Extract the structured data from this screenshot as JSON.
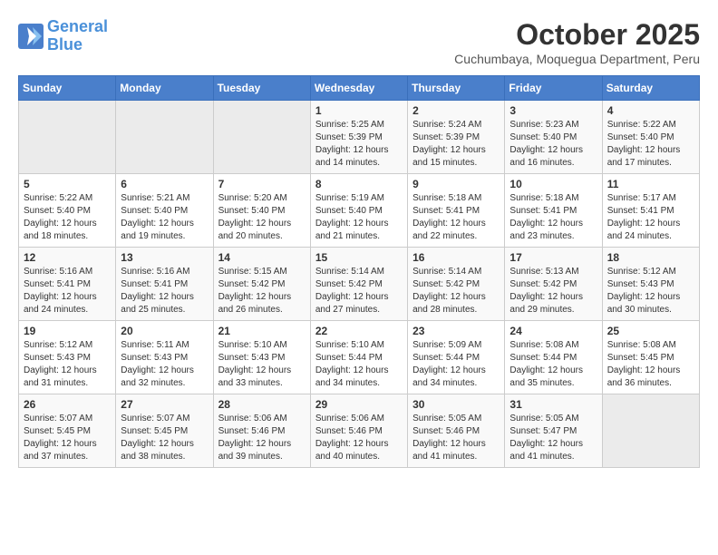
{
  "header": {
    "logo_line1": "General",
    "logo_line2": "Blue",
    "month": "October 2025",
    "location": "Cuchumbaya, Moquegua Department, Peru"
  },
  "weekdays": [
    "Sunday",
    "Monday",
    "Tuesday",
    "Wednesday",
    "Thursday",
    "Friday",
    "Saturday"
  ],
  "weeks": [
    [
      {
        "day": "",
        "sunrise": "",
        "sunset": "",
        "daylight": ""
      },
      {
        "day": "",
        "sunrise": "",
        "sunset": "",
        "daylight": ""
      },
      {
        "day": "",
        "sunrise": "",
        "sunset": "",
        "daylight": ""
      },
      {
        "day": "1",
        "sunrise": "5:25 AM",
        "sunset": "5:39 PM",
        "daylight": "12 hours and 14 minutes."
      },
      {
        "day": "2",
        "sunrise": "5:24 AM",
        "sunset": "5:39 PM",
        "daylight": "12 hours and 15 minutes."
      },
      {
        "day": "3",
        "sunrise": "5:23 AM",
        "sunset": "5:40 PM",
        "daylight": "12 hours and 16 minutes."
      },
      {
        "day": "4",
        "sunrise": "5:22 AM",
        "sunset": "5:40 PM",
        "daylight": "12 hours and 17 minutes."
      }
    ],
    [
      {
        "day": "5",
        "sunrise": "5:22 AM",
        "sunset": "5:40 PM",
        "daylight": "12 hours and 18 minutes."
      },
      {
        "day": "6",
        "sunrise": "5:21 AM",
        "sunset": "5:40 PM",
        "daylight": "12 hours and 19 minutes."
      },
      {
        "day": "7",
        "sunrise": "5:20 AM",
        "sunset": "5:40 PM",
        "daylight": "12 hours and 20 minutes."
      },
      {
        "day": "8",
        "sunrise": "5:19 AM",
        "sunset": "5:40 PM",
        "daylight": "12 hours and 21 minutes."
      },
      {
        "day": "9",
        "sunrise": "5:18 AM",
        "sunset": "5:41 PM",
        "daylight": "12 hours and 22 minutes."
      },
      {
        "day": "10",
        "sunrise": "5:18 AM",
        "sunset": "5:41 PM",
        "daylight": "12 hours and 23 minutes."
      },
      {
        "day": "11",
        "sunrise": "5:17 AM",
        "sunset": "5:41 PM",
        "daylight": "12 hours and 24 minutes."
      }
    ],
    [
      {
        "day": "12",
        "sunrise": "5:16 AM",
        "sunset": "5:41 PM",
        "daylight": "12 hours and 24 minutes."
      },
      {
        "day": "13",
        "sunrise": "5:16 AM",
        "sunset": "5:41 PM",
        "daylight": "12 hours and 25 minutes."
      },
      {
        "day": "14",
        "sunrise": "5:15 AM",
        "sunset": "5:42 PM",
        "daylight": "12 hours and 26 minutes."
      },
      {
        "day": "15",
        "sunrise": "5:14 AM",
        "sunset": "5:42 PM",
        "daylight": "12 hours and 27 minutes."
      },
      {
        "day": "16",
        "sunrise": "5:14 AM",
        "sunset": "5:42 PM",
        "daylight": "12 hours and 28 minutes."
      },
      {
        "day": "17",
        "sunrise": "5:13 AM",
        "sunset": "5:42 PM",
        "daylight": "12 hours and 29 minutes."
      },
      {
        "day": "18",
        "sunrise": "5:12 AM",
        "sunset": "5:43 PM",
        "daylight": "12 hours and 30 minutes."
      }
    ],
    [
      {
        "day": "19",
        "sunrise": "5:12 AM",
        "sunset": "5:43 PM",
        "daylight": "12 hours and 31 minutes."
      },
      {
        "day": "20",
        "sunrise": "5:11 AM",
        "sunset": "5:43 PM",
        "daylight": "12 hours and 32 minutes."
      },
      {
        "day": "21",
        "sunrise": "5:10 AM",
        "sunset": "5:43 PM",
        "daylight": "12 hours and 33 minutes."
      },
      {
        "day": "22",
        "sunrise": "5:10 AM",
        "sunset": "5:44 PM",
        "daylight": "12 hours and 34 minutes."
      },
      {
        "day": "23",
        "sunrise": "5:09 AM",
        "sunset": "5:44 PM",
        "daylight": "12 hours and 34 minutes."
      },
      {
        "day": "24",
        "sunrise": "5:08 AM",
        "sunset": "5:44 PM",
        "daylight": "12 hours and 35 minutes."
      },
      {
        "day": "25",
        "sunrise": "5:08 AM",
        "sunset": "5:45 PM",
        "daylight": "12 hours and 36 minutes."
      }
    ],
    [
      {
        "day": "26",
        "sunrise": "5:07 AM",
        "sunset": "5:45 PM",
        "daylight": "12 hours and 37 minutes."
      },
      {
        "day": "27",
        "sunrise": "5:07 AM",
        "sunset": "5:45 PM",
        "daylight": "12 hours and 38 minutes."
      },
      {
        "day": "28",
        "sunrise": "5:06 AM",
        "sunset": "5:46 PM",
        "daylight": "12 hours and 39 minutes."
      },
      {
        "day": "29",
        "sunrise": "5:06 AM",
        "sunset": "5:46 PM",
        "daylight": "12 hours and 40 minutes."
      },
      {
        "day": "30",
        "sunrise": "5:05 AM",
        "sunset": "5:46 PM",
        "daylight": "12 hours and 41 minutes."
      },
      {
        "day": "31",
        "sunrise": "5:05 AM",
        "sunset": "5:47 PM",
        "daylight": "12 hours and 41 minutes."
      },
      {
        "day": "",
        "sunrise": "",
        "sunset": "",
        "daylight": ""
      }
    ]
  ]
}
